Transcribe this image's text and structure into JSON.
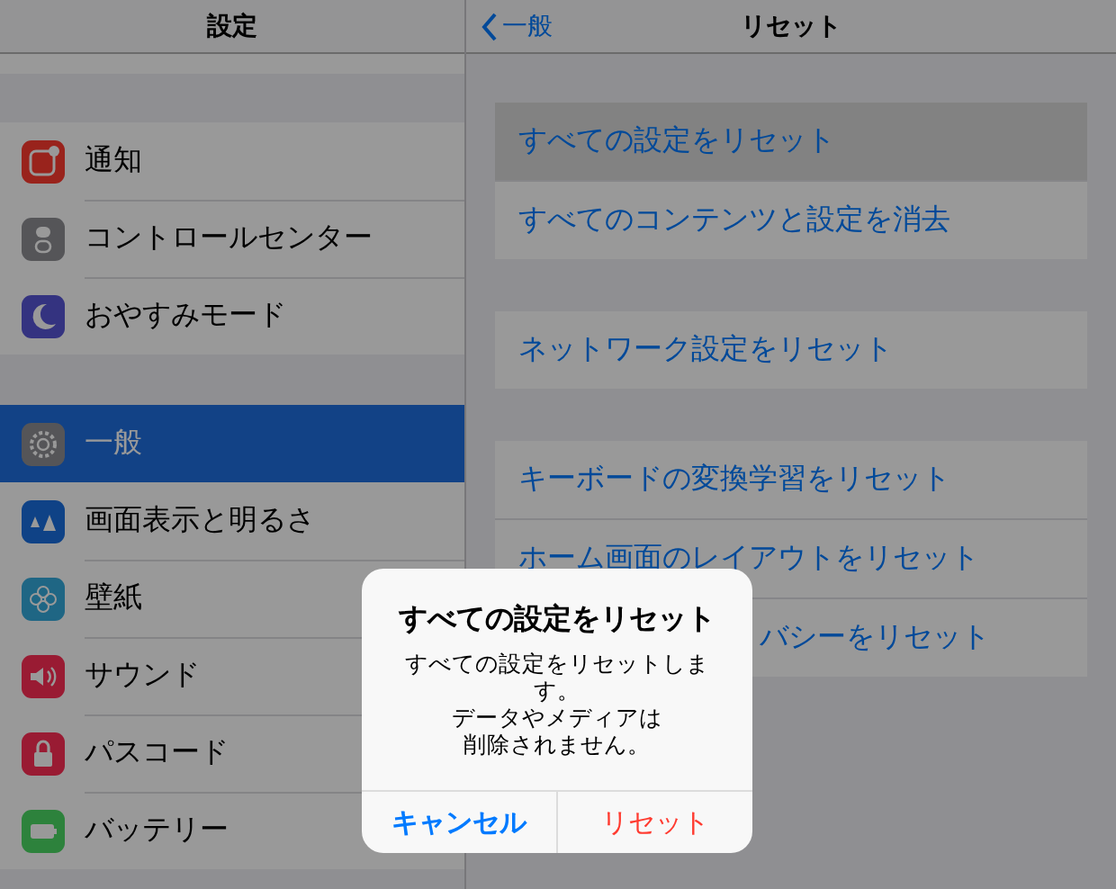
{
  "sidebar": {
    "title": "設定",
    "groups": [
      [
        {
          "label": "通知",
          "selected": false
        },
        {
          "label": "コントロールセンター",
          "selected": false
        },
        {
          "label": "おやすみモード",
          "selected": false
        }
      ],
      [
        {
          "label": "一般",
          "selected": true
        },
        {
          "label": "画面表示と明るさ",
          "selected": false
        },
        {
          "label": "壁紙",
          "selected": false
        },
        {
          "label": "サウンド",
          "selected": false
        },
        {
          "label": "パスコード",
          "selected": false
        },
        {
          "label": "バッテリー",
          "selected": false
        }
      ]
    ]
  },
  "detail": {
    "back": "一般",
    "title": "リセット",
    "groups": [
      [
        {
          "label": "すべての設定をリセット",
          "selected": true,
          "kind": "full"
        },
        {
          "label": "すべてのコンテンツと設定を消去",
          "selected": false,
          "kind": "full"
        }
      ],
      [
        {
          "label": "ネットワーク設定をリセット",
          "selected": false,
          "kind": "full"
        }
      ],
      [
        {
          "label": "キーボードの変換学習をリセット",
          "selected": false,
          "kind": "full"
        },
        {
          "label": "ホーム画面のレイアウトをリセット",
          "selected": false,
          "kind": "full"
        },
        {
          "label": "バシーをリセット",
          "selected": false,
          "kind": "covered"
        }
      ]
    ]
  },
  "alert": {
    "title": "すべての設定をリセット",
    "message": [
      "すべての設定をリセットします。",
      "データやメディアは",
      "削除されません。"
    ],
    "buttons": [
      {
        "label": "キャンセル",
        "kind": "cancel"
      },
      {
        "label": "リセット",
        "kind": "destructive"
      }
    ]
  }
}
